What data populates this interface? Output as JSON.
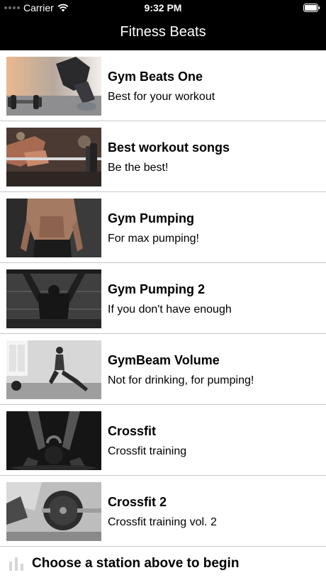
{
  "status_bar": {
    "carrier": "Carrier",
    "time": "9:32 PM"
  },
  "nav": {
    "title": "Fitness Beats"
  },
  "stations": [
    {
      "name": "Gym Beats One",
      "description": "Best for your workout",
      "image": "dumbbell-sneakers-photo"
    },
    {
      "name": "Best workout songs",
      "description": "Be the best!",
      "image": "barbell-grip-photo"
    },
    {
      "name": "Gym Pumping",
      "description": "For max pumping!",
      "image": "shirtless-torso-photo"
    },
    {
      "name": "Gym Pumping 2",
      "description": "If you don't have enough",
      "image": "pullup-back-photo"
    },
    {
      "name": "GymBeam Volume",
      "description": "Not for drinking, for pumping!",
      "image": "lunge-workout-photo"
    },
    {
      "name": "Crossfit",
      "description": "Crossfit training",
      "image": "kettlebell-photo"
    },
    {
      "name": "Crossfit 2",
      "description": "Crossfit training vol. 2",
      "image": "barbell-plate-photo"
    }
  ],
  "player": {
    "prompt": "Choose a station above to begin",
    "icon": "equalizer-icon"
  }
}
